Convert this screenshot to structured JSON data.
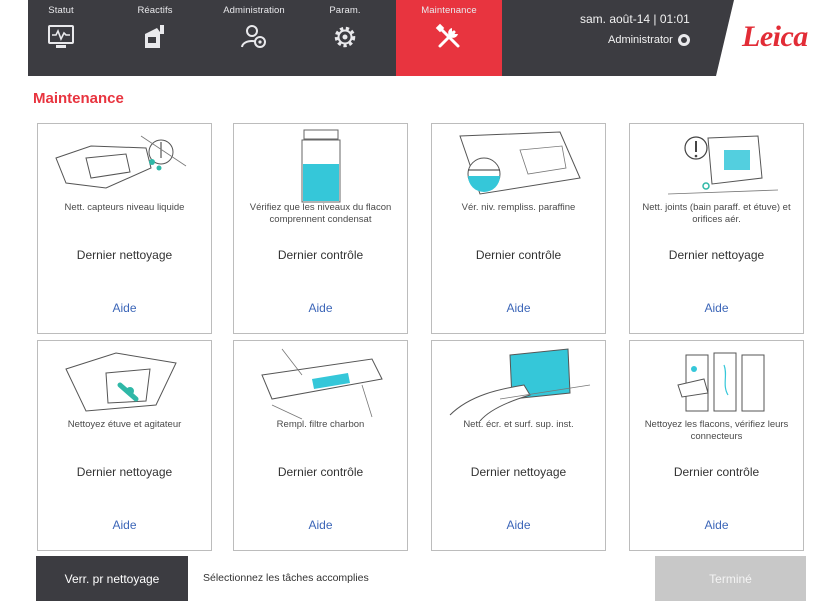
{
  "nav": {
    "tabs": [
      {
        "label": "Statut",
        "icon": "monitor-waveform-icon"
      },
      {
        "label": "Réactifs",
        "icon": "reagent-bottle-icon"
      },
      {
        "label": "Administration",
        "icon": "admin-user-gear-icon"
      },
      {
        "label": "Param.",
        "icon": "gear-icon"
      },
      {
        "label": "Maintenance",
        "icon": "tools-icon",
        "active": true
      }
    ]
  },
  "header": {
    "datetime": "sam. août-14 | 01:01",
    "user": "Administrator",
    "logo": "Leica"
  },
  "page": {
    "title": "Maintenance"
  },
  "cards": [
    {
      "task": "Nett. capteurs niveau liquide",
      "status": "Dernier nettoyage",
      "help": "Aide",
      "illustration": "retort-sensor-illustration"
    },
    {
      "task": "Vérifiez que les niveaux du flacon comprennent condensat",
      "status": "Dernier contrôle",
      "help": "Aide",
      "illustration": "condensate-bottle-illustration"
    },
    {
      "task": "Vér. niv. rempliss. paraffine",
      "status": "Dernier contrôle",
      "help": "Aide",
      "illustration": "paraffin-level-illustration"
    },
    {
      "task": "Nett. joints (bain paraff. et étuve) et orifices aér.",
      "status": "Dernier nettoyage",
      "help": "Aide",
      "illustration": "seals-vents-illustration"
    },
    {
      "task": "Nettoyez étuve et agitateur",
      "status": "Dernier nettoyage",
      "help": "Aide",
      "illustration": "retort-stirrer-illustration"
    },
    {
      "task": "Rempl. filtre charbon",
      "status": "Dernier contrôle",
      "help": "Aide",
      "illustration": "carbon-filter-illustration"
    },
    {
      "task": "Nett. écr. et surf. sup. inst.",
      "status": "Dernier nettoyage",
      "help": "Aide",
      "illustration": "screen-cleaning-illustration"
    },
    {
      "task": "Nettoyez les flacons, vérifiez leurs connecteurs",
      "status": "Dernier contrôle",
      "help": "Aide",
      "illustration": "bottles-connectors-illustration"
    }
  ],
  "footer": {
    "lock_label": "Verr. pr nettoyage",
    "hint": "Sélectionnez les tâches accomplies",
    "done_label": "Terminé"
  },
  "colors": {
    "accent": "#e8343f",
    "topbar": "#3c3c41",
    "link": "#3c66b8",
    "water": "#35c7d9",
    "disabled": "#c8c8c8"
  }
}
